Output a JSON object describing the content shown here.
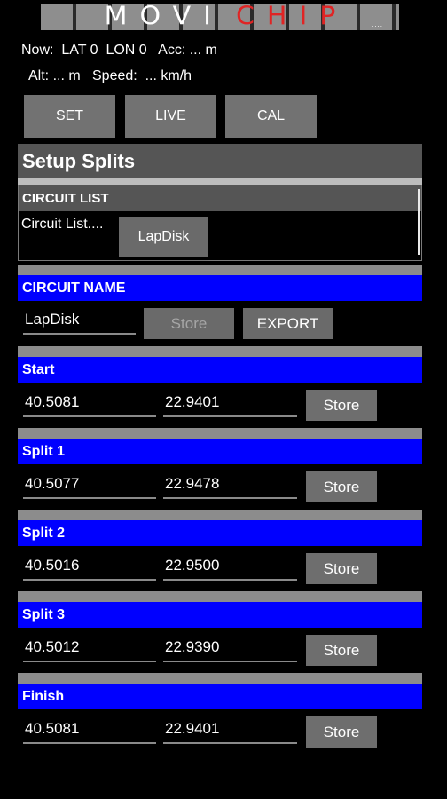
{
  "app": {
    "logo_part1": "MOVI",
    "logo_part2": "CHIP",
    "logo_suffix": "...."
  },
  "status": {
    "line1": "Now:  LAT 0  LON 0   Acc: ... m",
    "line2": "Alt: ... m   Speed:  ... km/h"
  },
  "top_buttons": {
    "set": "SET",
    "live": "LIVE",
    "cal": "CAL"
  },
  "page_title": "Setup Splits",
  "circuit_list": {
    "title": "CIRCUIT LIST",
    "label": "Circuit List....",
    "item": "LapDisk"
  },
  "circuit_name": {
    "title": "CIRCUIT NAME",
    "value": "LapDisk",
    "store_label": "Store",
    "export_label": "EXPORT"
  },
  "points": [
    {
      "label": "Start",
      "lat": "40.5081",
      "lon": "22.9401",
      "store": "Store"
    },
    {
      "label": "Split 1",
      "lat": "40.5077",
      "lon": "22.9478",
      "store": "Store"
    },
    {
      "label": "Split 2",
      "lat": "40.5016",
      "lon": "22.9500",
      "store": "Store"
    },
    {
      "label": "Split 3",
      "lat": "40.5012",
      "lon": "22.9390",
      "store": "Store"
    },
    {
      "label": "Finish",
      "lat": "40.5081",
      "lon": "22.9401",
      "store": "Store"
    }
  ],
  "colors": {
    "section_blue": "#0000ff",
    "header_gray": "#555555",
    "logo_red": "#e02424"
  }
}
